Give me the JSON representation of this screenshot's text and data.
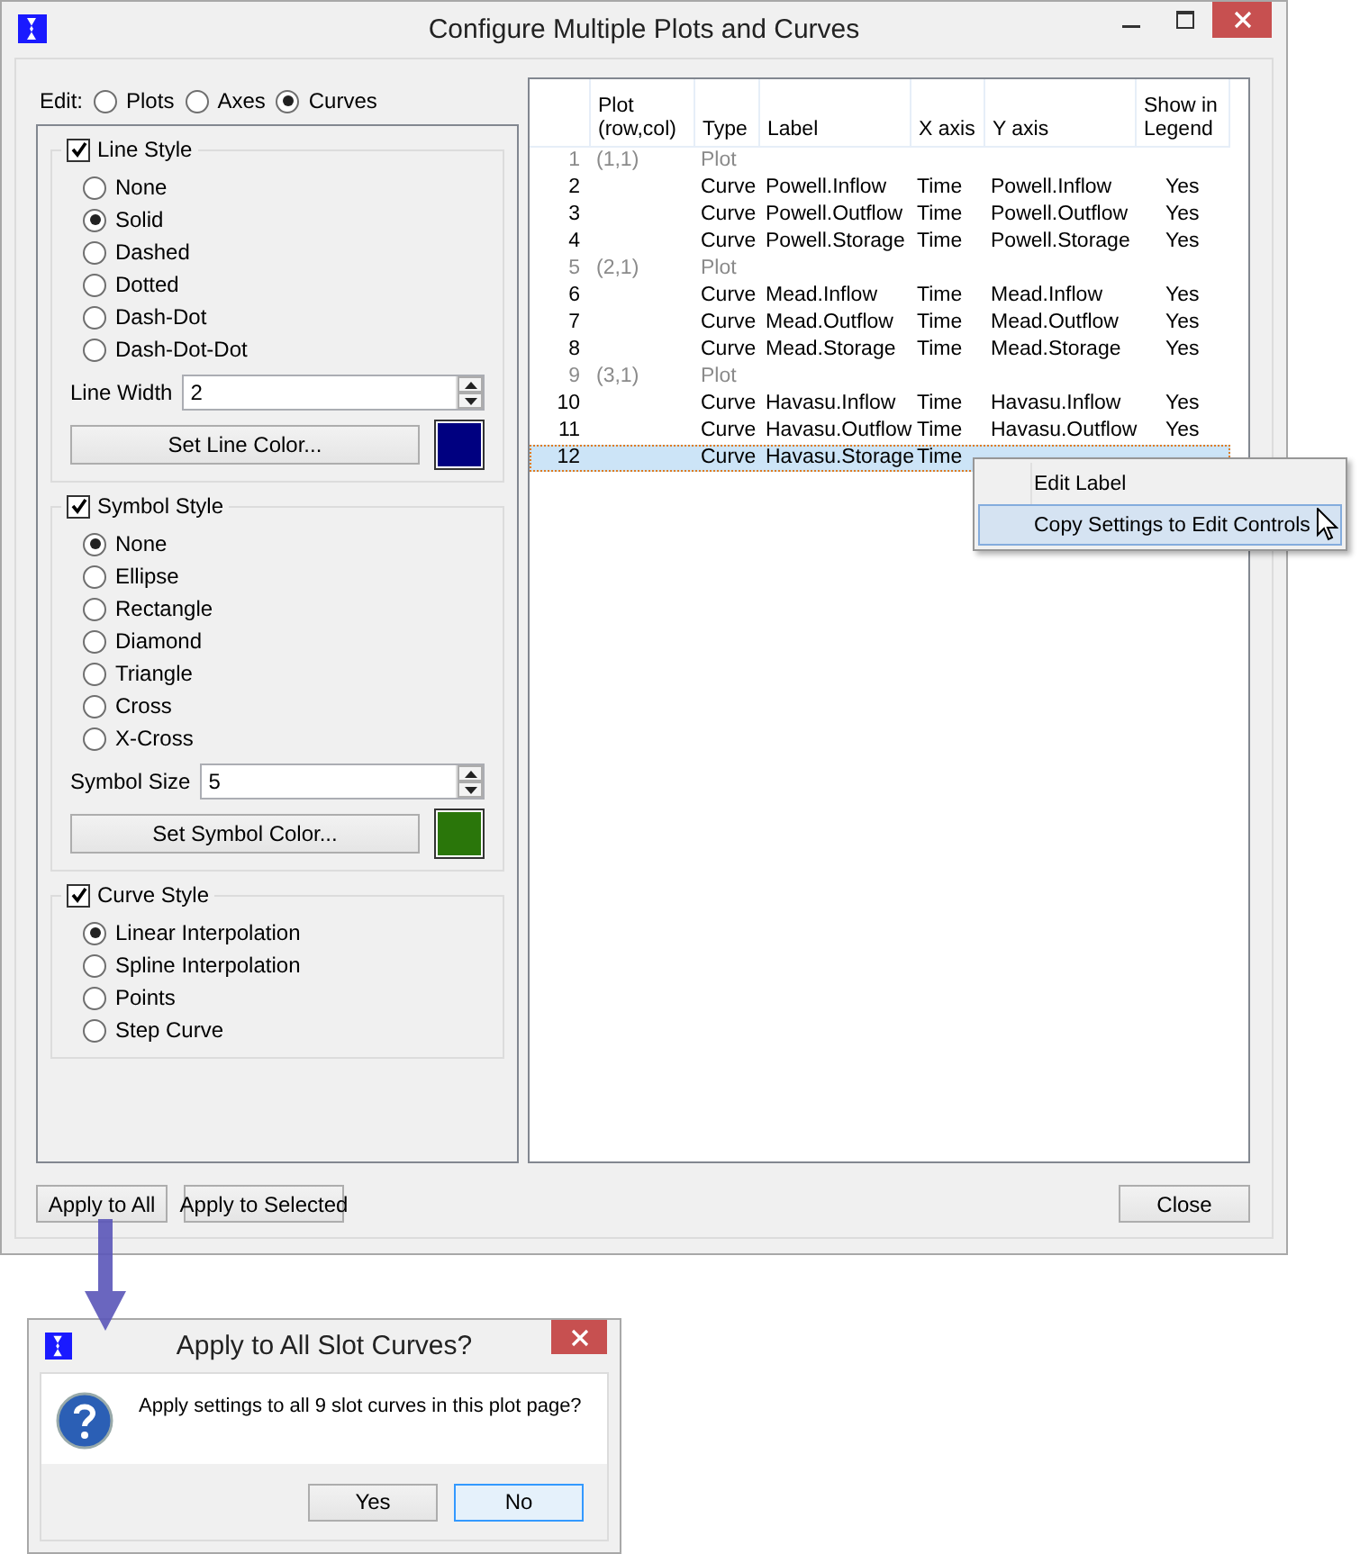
{
  "window": {
    "title": "Configure Multiple Plots and Curves"
  },
  "edit_mode": {
    "label": "Edit:",
    "options": [
      {
        "label": "Plots",
        "selected": false
      },
      {
        "label": "Axes",
        "selected": false
      },
      {
        "label": "Curves",
        "selected": true
      }
    ]
  },
  "line_style": {
    "label": "Line Style",
    "checked": true,
    "options": [
      {
        "label": "None",
        "selected": false
      },
      {
        "label": "Solid",
        "selected": true
      },
      {
        "label": "Dashed",
        "selected": false
      },
      {
        "label": "Dotted",
        "selected": false
      },
      {
        "label": "Dash-Dot",
        "selected": false
      },
      {
        "label": "Dash-Dot-Dot",
        "selected": false
      }
    ],
    "size_label": "Line Width",
    "size_value": "2",
    "color_button": "Set Line Color...",
    "color": "#000080"
  },
  "symbol_style": {
    "label": "Symbol Style",
    "checked": true,
    "options": [
      {
        "label": "None",
        "selected": true
      },
      {
        "label": "Ellipse",
        "selected": false
      },
      {
        "label": "Rectangle",
        "selected": false
      },
      {
        "label": "Diamond",
        "selected": false
      },
      {
        "label": "Triangle",
        "selected": false
      },
      {
        "label": "Cross",
        "selected": false
      },
      {
        "label": "X-Cross",
        "selected": false
      }
    ],
    "size_label": "Symbol Size",
    "size_value": "5",
    "color_button": "Set Symbol Color...",
    "color": "#2a760a"
  },
  "curve_style": {
    "label": "Curve Style",
    "checked": true,
    "options": [
      {
        "label": "Linear Interpolation",
        "selected": true
      },
      {
        "label": "Spline Interpolation",
        "selected": false
      },
      {
        "label": "Points",
        "selected": false
      },
      {
        "label": "Step Curve",
        "selected": false
      }
    ]
  },
  "table": {
    "columns": [
      "Plot\n(row,col)",
      "Type",
      "Label",
      "X axis",
      "Y axis",
      "Show in\nLegend"
    ],
    "rows": [
      {
        "number": "1",
        "kind": "plot",
        "plot": "(1,1)",
        "type": "Plot",
        "selected": false
      },
      {
        "number": "2",
        "kind": "curve",
        "type": "Curve",
        "label": "Powell.Inflow",
        "x_axis": "Time",
        "y_axis": "Powell.Inflow",
        "legend": "Yes",
        "selected": false
      },
      {
        "number": "3",
        "kind": "curve",
        "type": "Curve",
        "label": "Powell.Outflow",
        "x_axis": "Time",
        "y_axis": "Powell.Outflow",
        "legend": "Yes",
        "selected": false
      },
      {
        "number": "4",
        "kind": "curve",
        "type": "Curve",
        "label": "Powell.Storage",
        "x_axis": "Time",
        "y_axis": "Powell.Storage",
        "legend": "Yes",
        "selected": false
      },
      {
        "number": "5",
        "kind": "plot",
        "plot": "(2,1)",
        "type": "Plot",
        "selected": false
      },
      {
        "number": "6",
        "kind": "curve",
        "type": "Curve",
        "label": "Mead.Inflow",
        "x_axis": "Time",
        "y_axis": "Mead.Inflow",
        "legend": "Yes",
        "selected": false
      },
      {
        "number": "7",
        "kind": "curve",
        "type": "Curve",
        "label": "Mead.Outflow",
        "x_axis": "Time",
        "y_axis": "Mead.Outflow",
        "legend": "Yes",
        "selected": false
      },
      {
        "number": "8",
        "kind": "curve",
        "type": "Curve",
        "label": "Mead.Storage",
        "x_axis": "Time",
        "y_axis": "Mead.Storage",
        "legend": "Yes",
        "selected": false
      },
      {
        "number": "9",
        "kind": "plot",
        "plot": "(3,1)",
        "type": "Plot",
        "selected": false
      },
      {
        "number": "10",
        "kind": "curve",
        "type": "Curve",
        "label": "Havasu.Inflow",
        "x_axis": "Time",
        "y_axis": "Havasu.Inflow",
        "legend": "Yes",
        "selected": false
      },
      {
        "number": "11",
        "kind": "curve",
        "type": "Curve",
        "label": "Havasu.Outflow",
        "x_axis": "Time",
        "y_axis": "Havasu.Outflow",
        "legend": "Yes",
        "selected": false
      },
      {
        "number": "12",
        "kind": "curve",
        "type": "Curve",
        "label": "Havasu.Storage",
        "x_axis": "Time",
        "selected": true
      }
    ]
  },
  "context_menu": {
    "items": [
      {
        "label": "Edit Label",
        "selected": false
      },
      {
        "label": "Copy Settings to Edit Controls",
        "selected": true
      }
    ]
  },
  "buttons": {
    "apply_all": "Apply to All",
    "apply_selected": "Apply to Selected",
    "close": "Close"
  },
  "dialog": {
    "title": "Apply to All Slot Curves?",
    "message": "Apply settings to all 9 slot curves in this plot page?",
    "buttons": [
      {
        "label": "Yes",
        "selected": false
      },
      {
        "label": "No",
        "selected": true
      }
    ]
  }
}
